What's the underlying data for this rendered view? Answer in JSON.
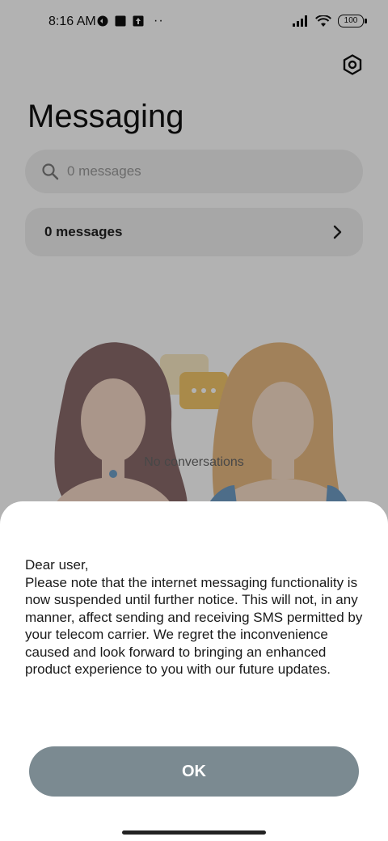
{
  "status_bar": {
    "time": "8:16 AM",
    "battery": "100",
    "left_icons": [
      "vpn-icon",
      "square-notification-icon",
      "upload-icon"
    ],
    "more_label": "··",
    "right_icons": [
      "signal-icon",
      "wifi-icon",
      "battery-icon"
    ]
  },
  "header": {
    "title": "Messaging",
    "settings_icon": "settings-icon"
  },
  "search": {
    "placeholder": "0 messages",
    "icon": "search-icon"
  },
  "summary_row": {
    "label": "0 messages",
    "icon": "chevron-right-icon"
  },
  "empty_state": {
    "text": "No conversations"
  },
  "dialog": {
    "message": "Dear user,\nPlease note that the internet messaging functionality is now suspended until further notice. This will not, in any manner, affect sending and receiving SMS permitted by your telecom carrier. We regret the inconvenience caused and look forward to bringing an enhanced product experience to you with our future updates.",
    "ok_label": "OK"
  },
  "colors": {
    "ok_button": "#7b8a91",
    "scrim": "rgba(0,0,0,0.30)"
  }
}
